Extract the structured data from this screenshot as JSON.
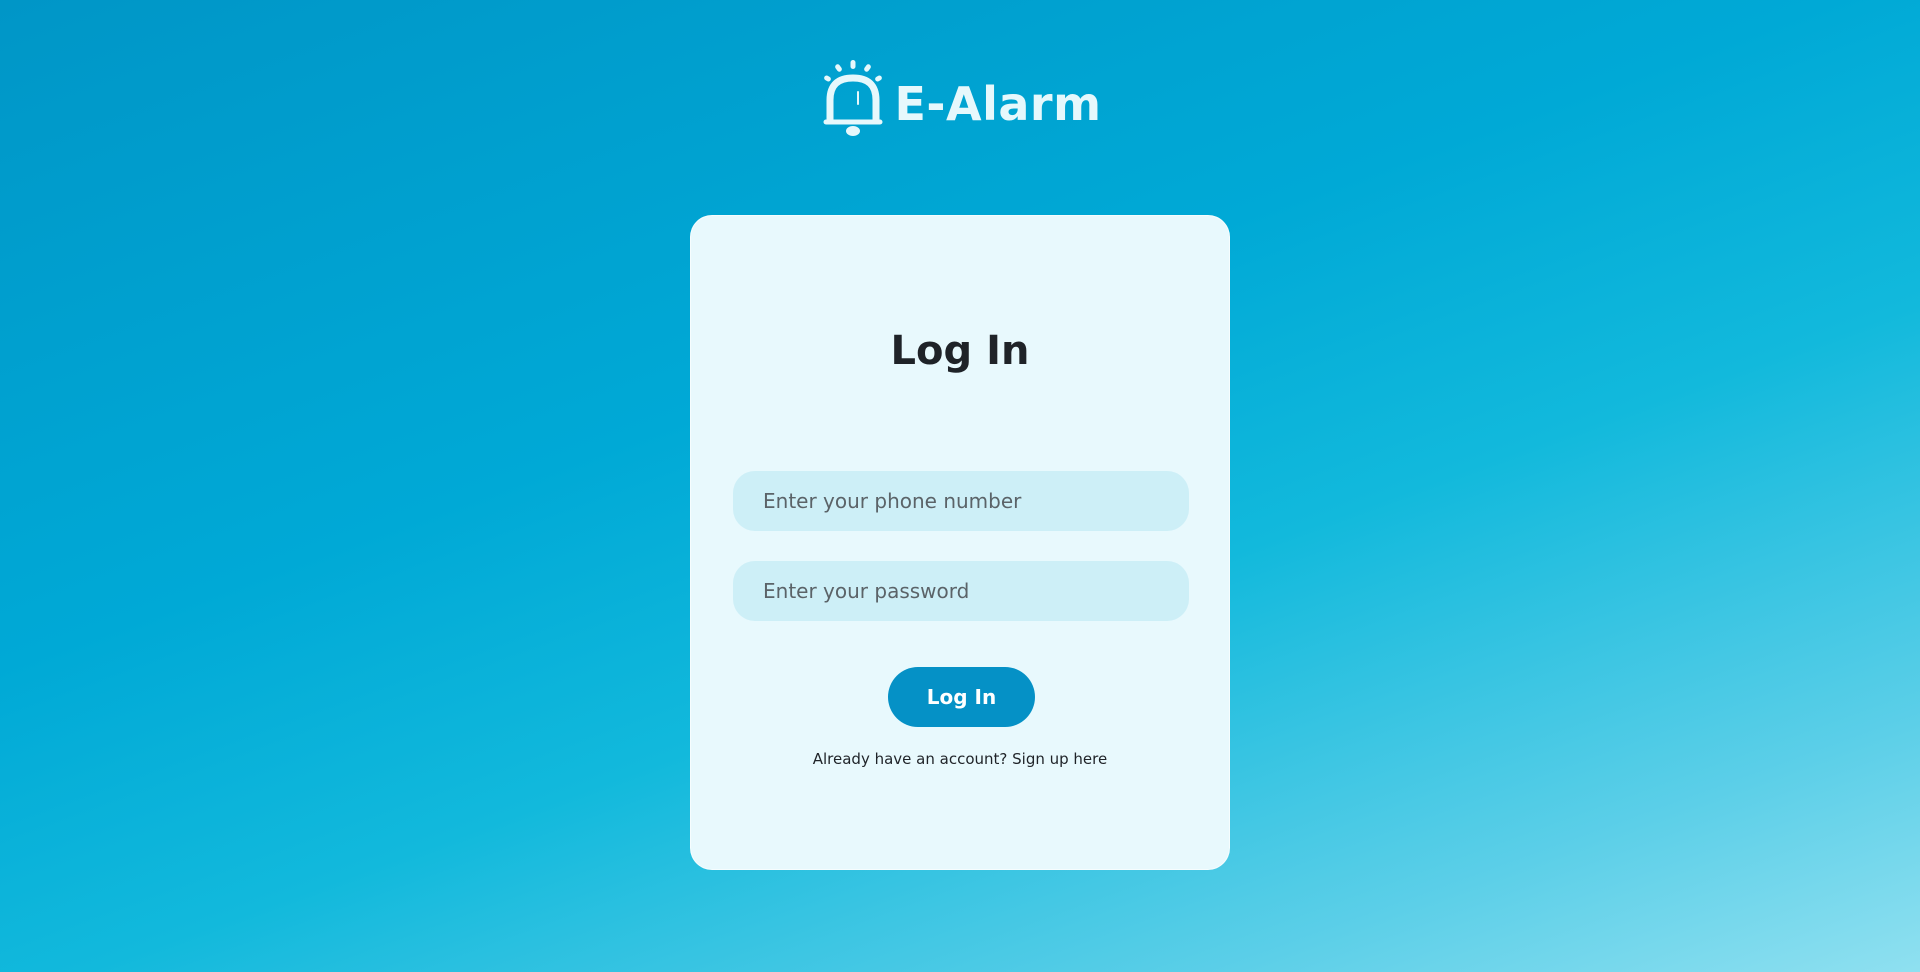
{
  "brand": {
    "name": "E-Alarm",
    "logo_icon": "alarm-bell-icon"
  },
  "login": {
    "title": "Log In",
    "phone_placeholder": "Enter your phone number",
    "password_placeholder": "Enter your password",
    "submit_label": "Log In",
    "signup_prompt": "Already have an account? ",
    "signup_link": "Sign up here"
  },
  "colors": {
    "background_top": "#0096c7",
    "background_bottom": "#8fe0f0",
    "card": "#e8f9fd",
    "input_fill": "#cdeff7",
    "button": "#0591c6",
    "brand_text": "#e6f8fc"
  }
}
